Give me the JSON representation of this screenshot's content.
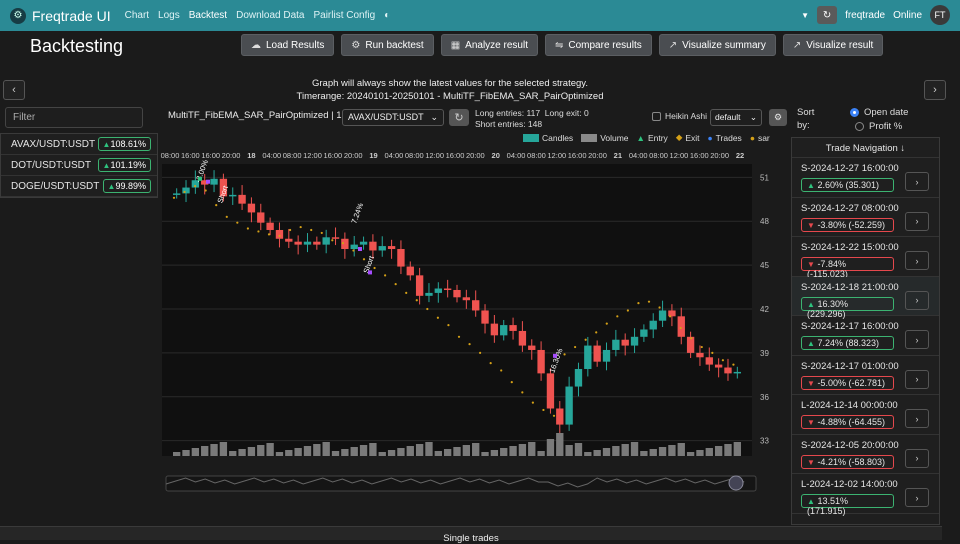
{
  "nav": {
    "brand": "Freqtrade UI",
    "links": [
      "Chart",
      "Logs",
      "Backtest",
      "Download Data",
      "Pairlist Config"
    ],
    "user": "freqtrade",
    "status": "Online",
    "avatar": "FT"
  },
  "page_title": "Backtesting",
  "toolbar": [
    {
      "label": "Load Results",
      "icon": "cloud-upload-icon"
    },
    {
      "label": "Run backtest",
      "icon": "gear-icon"
    },
    {
      "label": "Analyze result",
      "icon": "calculator-icon"
    },
    {
      "label": "Compare results",
      "icon": "compare-icon"
    },
    {
      "label": "Visualize summary",
      "icon": "chart-line-icon"
    },
    {
      "label": "Visualize result",
      "icon": "chart-line-icon"
    }
  ],
  "info_line1": "Graph will always show the latest values for the selected strategy.",
  "info_line2": "Timerange: 20240101-20250101 - MultiTF_FibEMA_SAR_PairOptimized",
  "filter_placeholder": "Filter",
  "pairs": [
    {
      "name": "AVAX/USDT:USDT",
      "pct": "108.61%"
    },
    {
      "name": "DOT/USDT:USDT",
      "pct": "101.19%"
    },
    {
      "name": "DOGE/USDT:USDT",
      "pct": "99.89%"
    }
  ],
  "chart_header": {
    "strategy": "MultiTF_FibEMA_SAR_PairOptimized | 1h",
    "pair_select": "AVAX/USDT:USDT",
    "long_entries": "Long entries: 117",
    "long_exit": "Long exit: 0",
    "short_entries": "Short entries: 148",
    "heikin": "Heikin Ashi",
    "layout_select": "default"
  },
  "legend": [
    "Candles",
    "Volume",
    "Entry",
    "Exit",
    "Trades",
    "sar"
  ],
  "colors": {
    "up": "#26a69a",
    "down": "#ef5350",
    "sar": "#d4a017",
    "volume": "#8a8a8a",
    "accent": "#2b8a95"
  },
  "chart_data": {
    "type": "candlestick",
    "pair": "AVAX/USDT:USDT",
    "y_ticks": [
      51,
      48,
      45,
      42,
      39,
      36,
      33
    ],
    "x_ticks": [
      "08:00",
      "16:00",
      "16:00",
      "20:00",
      "18",
      "04:00",
      "08:00",
      "12:00",
      "16:00",
      "20:00",
      "19",
      "04:00",
      "08:00",
      "12:00",
      "16:00",
      "20:00",
      "20",
      "04:00",
      "08:00",
      "12:00",
      "16:00",
      "20:00",
      "21",
      "04:00",
      "08:00",
      "12:00",
      "16:00",
      "20:00",
      "22"
    ],
    "trade_labels": [
      "-3.00%",
      "Short",
      "7.24%",
      "Short",
      "16.30%"
    ],
    "close_path": [
      49.9,
      50.3,
      50.8,
      50.5,
      50.9,
      49.7,
      49.8,
      49.2,
      48.6,
      47.9,
      47.4,
      46.8,
      46.6,
      46.4,
      46.6,
      46.4,
      46.9,
      46.8,
      46.1,
      46.4,
      46.6,
      46.0,
      46.3,
      46.1,
      44.9,
      44.3,
      42.9,
      43.1,
      43.4,
      43.3,
      42.8,
      42.6,
      41.9,
      41.0,
      40.2,
      40.9,
      40.5,
      39.5,
      39.2,
      37.6,
      35.2,
      34.1,
      36.7,
      37.9,
      39.5,
      38.4,
      39.2,
      39.9,
      39.5,
      40.1,
      40.6,
      41.2,
      41.9,
      41.5,
      40.1,
      39.0,
      38.7,
      38.2,
      38.0,
      37.6,
      37.7
    ],
    "sar_path": [
      49.6,
      50.0,
      50.4,
      50.1,
      49.1,
      48.3,
      47.9,
      47.5,
      47.3,
      47.1,
      47.0,
      47.4,
      47.6,
      47.4,
      47.2,
      46.7,
      46.5,
      46.0,
      45.4,
      44.8,
      44.3,
      43.7,
      43.1,
      42.6,
      42.0,
      41.4,
      40.9,
      40.1,
      39.6,
      39.0,
      38.3,
      37.8,
      37.0,
      36.3,
      35.6,
      35.1,
      34.7,
      38.9,
      39.4,
      39.9,
      40.4,
      41.0,
      41.5,
      41.9,
      42.4,
      42.5,
      42.1,
      41.5,
      40.7,
      40.0,
      39.4,
      39.0,
      38.5,
      38.2
    ]
  },
  "sort": {
    "label": "Sort by:",
    "options": [
      "Open date",
      "Profit %"
    ]
  },
  "trade_nav": {
    "header": "Trade Navigation ↓",
    "trades": [
      {
        "date": "S-2024-12-27 16:00:00",
        "profit": "2.60% (35.301)",
        "dir": "up"
      },
      {
        "date": "S-2024-12-27 08:00:00",
        "profit": "-3.80% (-52.259)",
        "dir": "down"
      },
      {
        "date": "S-2024-12-22 15:00:00",
        "profit": "-7.84% (-115.023)",
        "dir": "down"
      },
      {
        "date": "S-2024-12-18 21:00:00",
        "profit": "16.30% (229.296)",
        "dir": "up"
      },
      {
        "date": "S-2024-12-17 16:00:00",
        "profit": "7.24% (88.323)",
        "dir": "up"
      },
      {
        "date": "S-2024-12-17 01:00:00",
        "profit": "-5.00% (-62.781)",
        "dir": "down"
      },
      {
        "date": "L-2024-12-14 00:00:00",
        "profit": "-4.88% (-64.455)",
        "dir": "down"
      },
      {
        "date": "S-2024-12-05 20:00:00",
        "profit": "-4.21% (-58.803)",
        "dir": "down"
      },
      {
        "date": "L-2024-12-02 14:00:00",
        "profit": "13.51% (171.915)",
        "dir": "up"
      }
    ]
  },
  "bottom_label": "Single trades"
}
